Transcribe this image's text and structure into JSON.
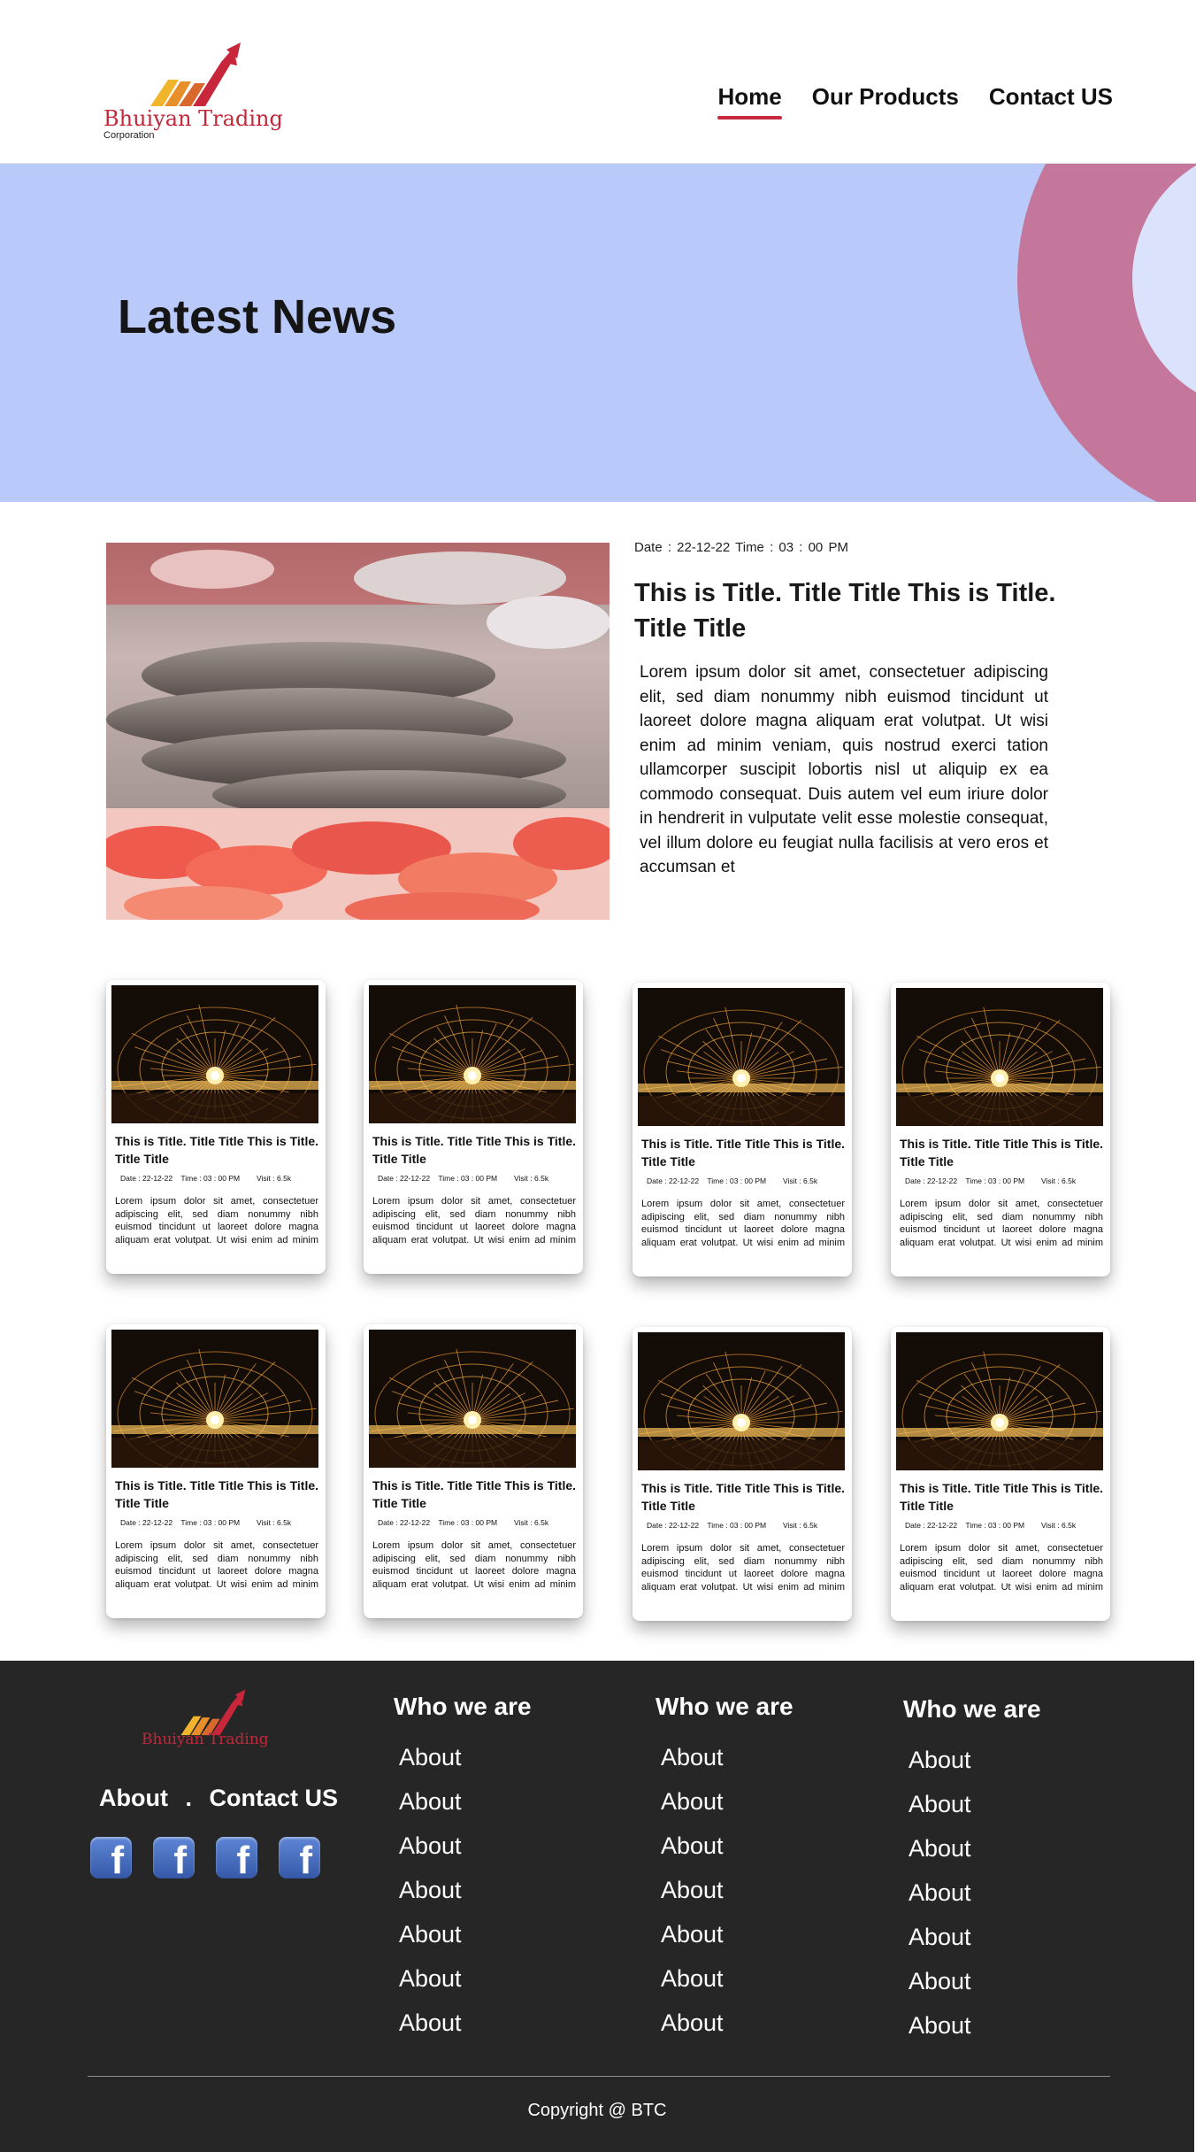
{
  "header": {
    "brand_name": "Bhuiyan Trading",
    "brand_sub": "Corporation",
    "nav": [
      {
        "label": "Home",
        "active": true
      },
      {
        "label": "Our Products",
        "active": false
      },
      {
        "label": "Contact US",
        "active": false
      }
    ]
  },
  "hero": {
    "title": "Latest News"
  },
  "featured": {
    "meta": "Date : 22-12-22    Time : 03 : 00 PM",
    "title": "This is Title. Title Title This is Title. Title Title",
    "body": "Lorem ipsum dolor sit amet, consectetuer adipiscing elit, sed diam nonummy nibh euismod tincidunt ut laoreet dolore magna aliquam erat volutpat. Ut wisi enim ad minim veniam, quis nostrud exerci tation ullamcorper suscipit lobortis nisl ut aliquip ex ea commodo consequat. Duis autem vel eum iriure dolor in hendrerit in vulputate velit esse molestie consequat, vel illum dolore eu feugiat nulla facilisis at vero eros et accumsan et"
  },
  "cards": [
    {
      "title": "This is Title. Title Title This is Title. Title Title",
      "meta": "Date : 22-12-22    Time : 03 : 00 PM        Visit : 6.5k",
      "body": "Lorem ipsum dolor sit amet, consectetuer adipiscing elit, sed diam nonummy nibh euismod tincidunt ut laoreet dolore magna aliquam erat volutpat. Ut wisi enim ad minim veniam, quis nostrud exerci tation ullamcorper"
    },
    {
      "title": "This is Title. Title Title This is Title. Title Title",
      "meta": "Date : 22-12-22    Time : 03 : 00 PM        Visit : 6.5k",
      "body": "Lorem ipsum dolor sit amet, consectetuer adipiscing elit, sed diam nonummy nibh euismod tincidunt ut laoreet dolore magna aliquam erat volutpat. Ut wisi enim ad minim veniam, quis nostrud exerci tation ullamcorper"
    },
    {
      "title": "This is Title. Title Title This is Title. Title Title",
      "meta": "Date : 22-12-22    Time : 03 : 00 PM        Visit : 6.5k",
      "body": "Lorem ipsum dolor sit amet, consectetuer adipiscing elit, sed diam nonummy nibh euismod tincidunt ut laoreet dolore magna aliquam erat volutpat. Ut wisi enim ad minim veniam, quis nostrud exerci tation ullamcorper"
    },
    {
      "title": "This is Title. Title Title This is Title. Title Title",
      "meta": "Date : 22-12-22    Time : 03 : 00 PM        Visit : 6.5k",
      "body": "Lorem ipsum dolor sit amet, consectetuer adipiscing elit, sed diam nonummy nibh euismod tincidunt ut laoreet dolore magna aliquam erat volutpat. Ut wisi enim ad minim veniam, quis nostrud exerci tation ullamcorper"
    },
    {
      "title": "This is Title. Title Title This is Title. Title Title",
      "meta": "Date : 22-12-22    Time : 03 : 00 PM        Visit : 6.5k",
      "body": "Lorem ipsum dolor sit amet, consectetuer adipiscing elit, sed diam nonummy nibh euismod tincidunt ut laoreet dolore magna aliquam erat volutpat. Ut wisi enim ad minim veniam, quis nostrud exerci tation ullamcorper"
    },
    {
      "title": "This is Title. Title Title This is Title. Title Title",
      "meta": "Date : 22-12-22    Time : 03 : 00 PM        Visit : 6.5k",
      "body": "Lorem ipsum dolor sit amet, consectetuer adipiscing elit, sed diam nonummy nibh euismod tincidunt ut laoreet dolore magna aliquam erat volutpat. Ut wisi enim ad minim veniam, quis nostrud exerci tation ullamcorper"
    },
    {
      "title": "This is Title. Title Title This is Title. Title Title",
      "meta": "Date : 22-12-22    Time : 03 : 00 PM        Visit : 6.5k",
      "body": "Lorem ipsum dolor sit amet, consectetuer adipiscing elit, sed diam nonummy nibh euismod tincidunt ut laoreet dolore magna aliquam erat volutpat. Ut wisi enim ad minim veniam, quis nostrud exerci tation ullamcorper"
    },
    {
      "title": "This is Title. Title Title This is Title. Title Title",
      "meta": "Date : 22-12-22    Time : 03 : 00 PM        Visit : 6.5k",
      "body": "Lorem ipsum dolor sit amet, consectetuer adipiscing elit, sed diam nonummy nibh euismod tincidunt ut laoreet dolore magna aliquam erat volutpat. Ut wisi enim ad minim veniam, quis nostrud exerci tation ullamcorper"
    }
  ],
  "footer": {
    "brand_name": "Bhuiyan Trading",
    "link_about": "About",
    "link_sep": ".",
    "link_contact": "Contact US",
    "social": [
      "facebook-icon",
      "facebook-icon",
      "facebook-icon",
      "facebook-icon"
    ],
    "columns": [
      {
        "heading": "Who we are",
        "items": [
          "About",
          "About",
          "About",
          "About",
          "About",
          "About",
          "About"
        ]
      },
      {
        "heading": "Who we are",
        "items": [
          "About",
          "About",
          "About",
          "About",
          "About",
          "About",
          "About"
        ]
      },
      {
        "heading": "Who we are",
        "items": [
          "About",
          "About",
          "About",
          "About",
          "About",
          "About",
          "About"
        ]
      }
    ],
    "copyright": "Copyright @ BTC"
  },
  "colors": {
    "accent": "#c72a3e",
    "hero_bg": "#b8c9fa",
    "footer_bg": "#262626",
    "ring": "#c4779b"
  }
}
